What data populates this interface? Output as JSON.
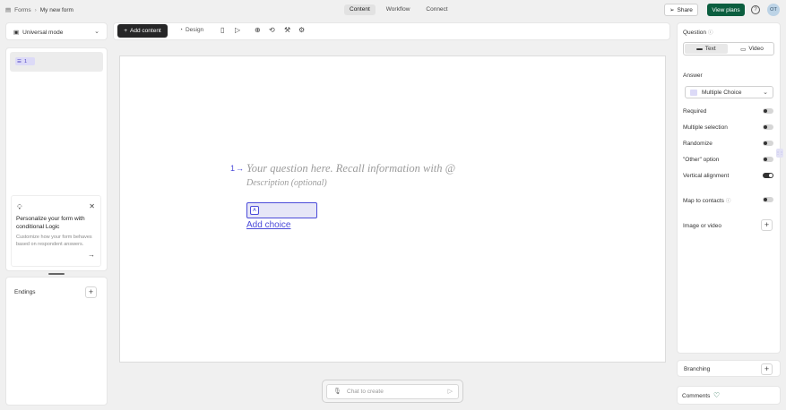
{
  "header": {
    "app_label": "Forms",
    "separator": "›",
    "form_name": "My new form",
    "tabs": [
      {
        "label": "Content",
        "active": true
      },
      {
        "label": "Workflow",
        "active": false
      },
      {
        "label": "Connect",
        "active": false
      }
    ],
    "share_label": "Share",
    "plans_label": "View plans",
    "avatar_initials": "OT",
    "accent_color": "#0b5e3f"
  },
  "left": {
    "mode_label": "Universal mode",
    "question_number": "1",
    "promo_title": "Personalize your form with conditional Logic",
    "promo_desc": "Customize how your form behaves based on respondent answers.",
    "endings_label": "Endings"
  },
  "toolbar": {
    "add_content_label": "Add content",
    "design_label": "Design"
  },
  "question": {
    "number": "1",
    "arrow": "→",
    "placeholder": "Your question here. Recall information with @",
    "description": "Description (optional)",
    "choice_key": "A",
    "add_choice": "Add choice",
    "accent_color": "#4b4bd9"
  },
  "chat": {
    "placeholder": "Chat to create"
  },
  "settings": {
    "question_label": "Question",
    "media_tabs": [
      {
        "label": "Text",
        "selected": true
      },
      {
        "label": "Video",
        "selected": false
      }
    ],
    "answer_label": "Answer",
    "answer_type": "Multiple Choice",
    "options": [
      {
        "label": "Required",
        "on": false
      },
      {
        "label": "Multiple selection",
        "on": false
      },
      {
        "label": "Randomize",
        "on": false
      },
      {
        "label": "\"Other\" option",
        "on": false
      },
      {
        "label": "Vertical alignment",
        "on": true
      }
    ],
    "map_contacts_label": "Map to contacts",
    "map_contacts_on": false,
    "image_video_label": "Image or video",
    "branching_label": "Branching",
    "comments_label": "Comments"
  }
}
